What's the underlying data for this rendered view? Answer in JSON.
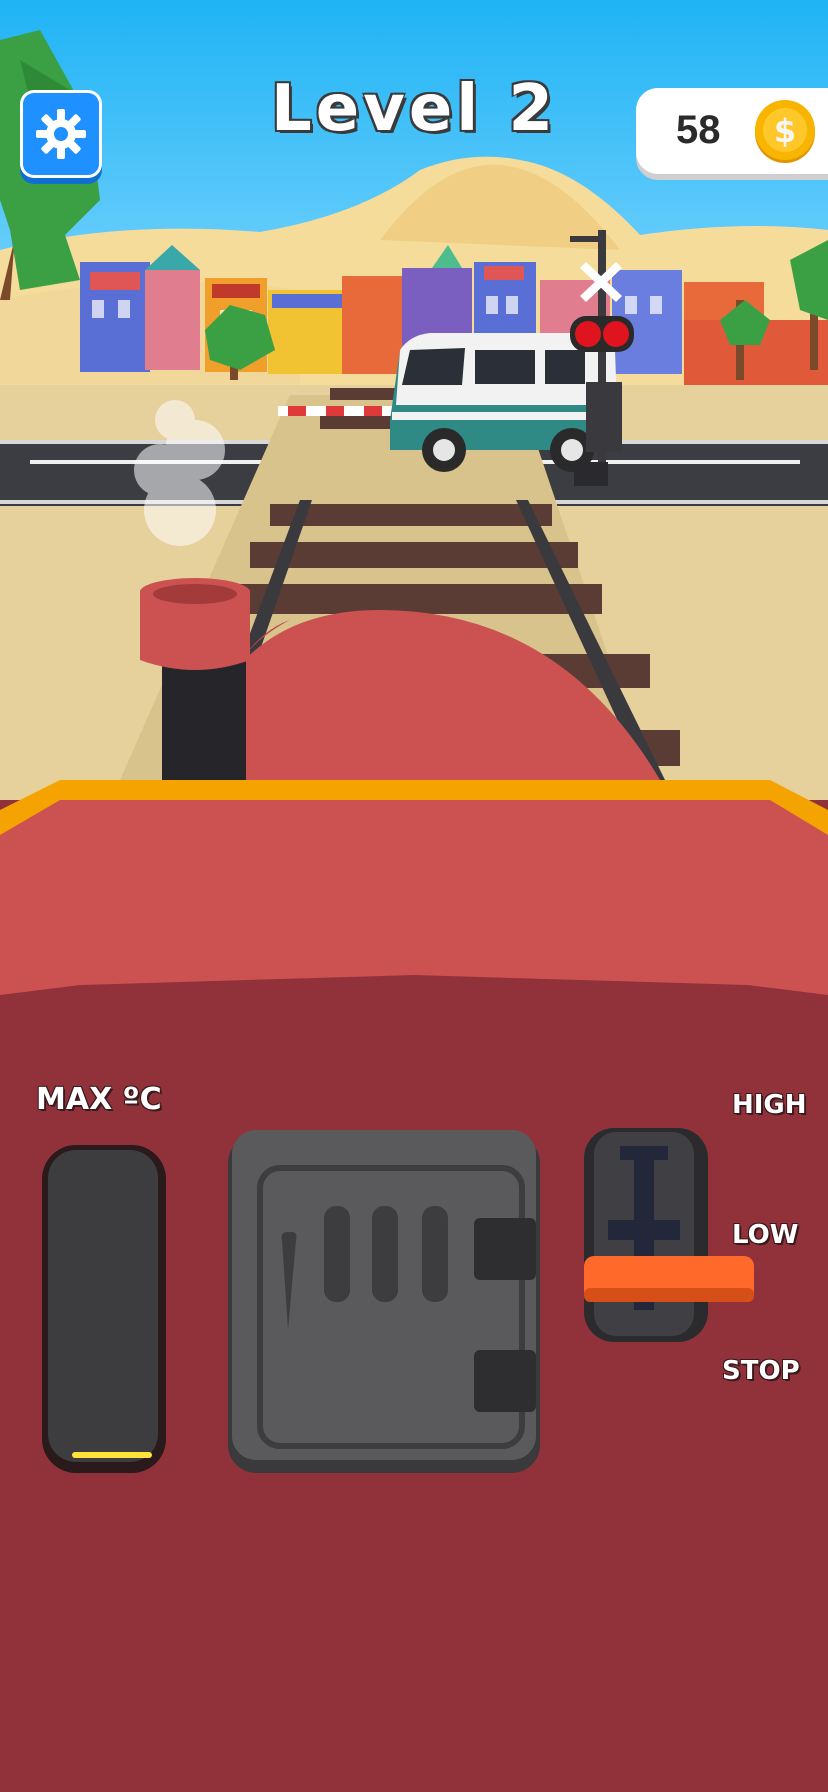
{
  "hud": {
    "level_title": "Level 2",
    "coins": "58",
    "coin_symbol": "$",
    "settings_icon": "gear-icon",
    "coin_icon": "dollar-coin-icon"
  },
  "controls": {
    "temperature_label": "MAX ºC",
    "throttle_labels": {
      "high": "HIGH",
      "low": "LOW",
      "stop": "STOP"
    },
    "throttle_position": "low",
    "temperature_level": 0.02
  },
  "colors": {
    "sky": "#29b8f5",
    "dash": "#91323a",
    "cab": "#cc5252",
    "trim": "#f5a300",
    "button": "#1e90ff",
    "coin": "#f7b500",
    "lever": "#ff6a2a"
  }
}
